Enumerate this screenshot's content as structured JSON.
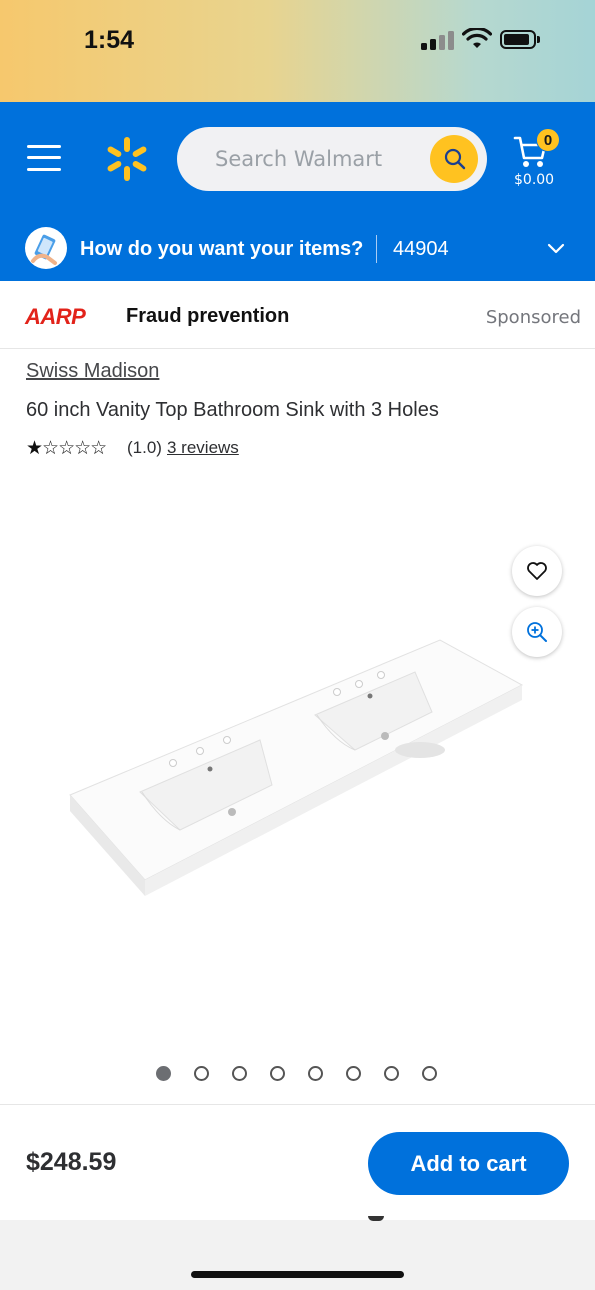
{
  "status_bar": {
    "time": "1:54"
  },
  "header": {
    "search": {
      "placeholder": "Search Walmart"
    },
    "cart": {
      "count": "0",
      "total": "$0.00"
    },
    "delivery": {
      "prompt": "How do you want your items?",
      "zip": "44904"
    },
    "colors": {
      "brand_blue": "#0071dc",
      "spark_yellow": "#ffc220"
    }
  },
  "ad": {
    "logo_text": "AARP",
    "title": "Fraud prevention",
    "sponsored_label": "Sponsored"
  },
  "product": {
    "brand": "Swiss Madison",
    "title": "60 inch Vanity Top Bathroom Sink with 3 Holes",
    "stars": "★☆☆☆☆",
    "rating": 1,
    "rating_text": "(1.0)",
    "reviews_text": "3 reviews",
    "image_count": 8,
    "active_image_index": 0
  },
  "purchase": {
    "price": "$248.59",
    "add_to_cart_label": "Add to cart"
  },
  "icons": {
    "menu": "menu-icon",
    "spark": "walmart-spark-icon",
    "search": "search-icon",
    "cart": "cart-icon",
    "chevron": "chevron-down-icon",
    "favorite": "heart-icon",
    "zoom": "zoom-in-icon"
  }
}
